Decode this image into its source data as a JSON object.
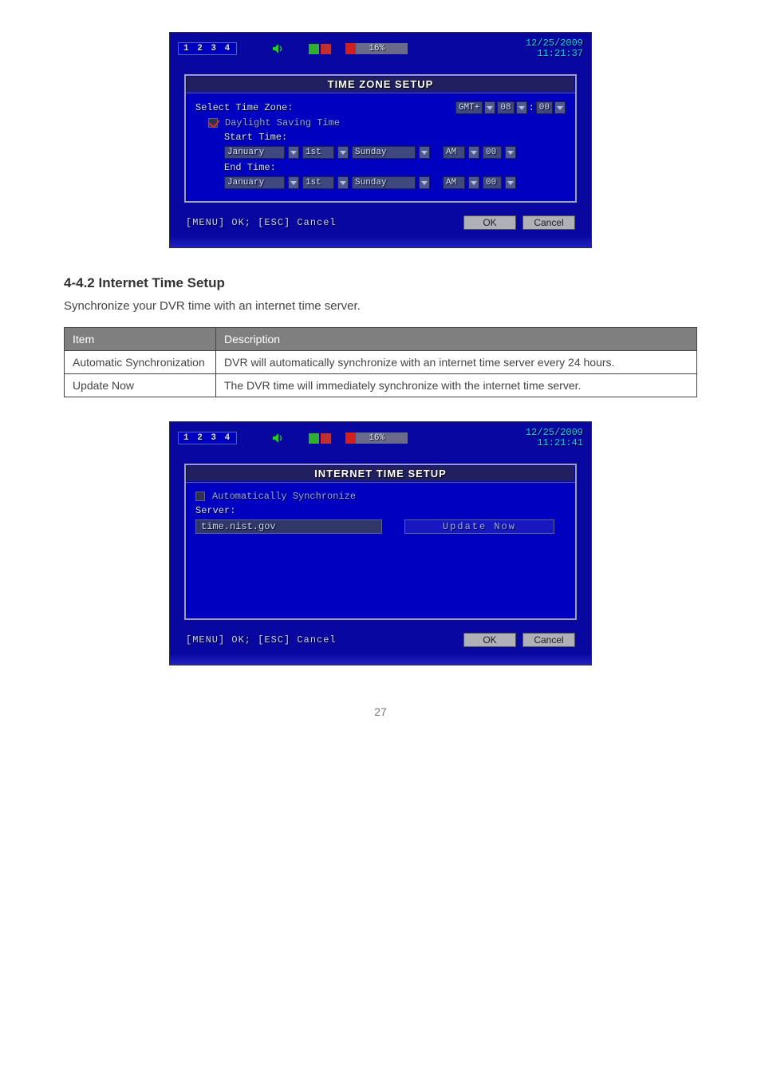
{
  "dvr1": {
    "channels": "1 2 3 4",
    "disk_pct_text": "16%",
    "disk_pct": 16,
    "date": "12/25/2009",
    "time": "11:21:37",
    "panel_title": "TIME ZONE SETUP",
    "select_time_zone_label": "Select Time Zone:",
    "gmt_sign": "GMT+",
    "gmt_hour": "08",
    "gmt_min": "00",
    "dst_label": "Daylight Saving Time",
    "start_time_label": "Start Time:",
    "end_time_label": "End Time:",
    "months": [
      "January",
      "January"
    ],
    "ordinals": [
      "1st",
      "1st"
    ],
    "days": [
      "Sunday",
      "Sunday"
    ],
    "ampm": [
      "AM",
      "AM"
    ],
    "hours": [
      "00",
      "00"
    ],
    "hint": "[MENU] OK; [ESC] Cancel",
    "ok": "OK",
    "cancel": "Cancel"
  },
  "section_heading": "4-4.2 Internet Time Setup",
  "caption": "Synchronize your DVR time with an internet time server.",
  "table": {
    "h1": "Item",
    "h2": "Description",
    "r1c1": "Automatic Synchronization",
    "r1c2": "DVR will automatically synchronize with an internet time server every 24 hours.",
    "r2c1": "Update Now",
    "r2c2": "The DVR time will immediately synchronize with the internet time server."
  },
  "dvr2": {
    "channels": "1 2 3 4",
    "disk_pct_text": "16%",
    "disk_pct": 16,
    "date": "12/25/2009",
    "time": "11:21:41",
    "panel_title": "INTERNET TIME SETUP",
    "auto_sync_label": "Automatically Synchronize",
    "server_label": "Server:",
    "server_value": "time.nist.gov",
    "update_now": "Update Now",
    "hint": "[MENU] OK; [ESC] Cancel",
    "ok": "OK",
    "cancel": "Cancel"
  },
  "page_number": "27"
}
